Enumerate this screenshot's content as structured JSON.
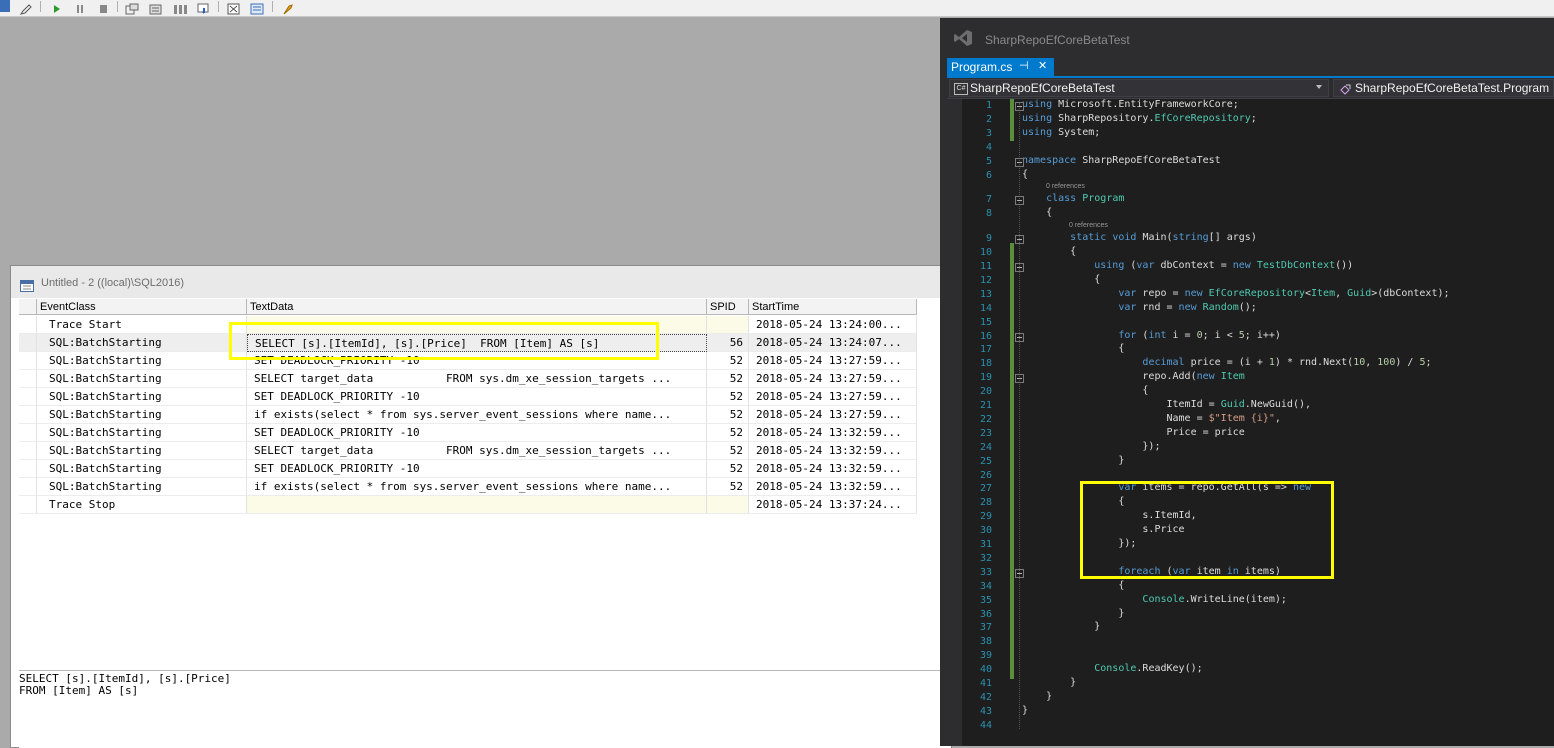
{
  "toolbar": {
    "icons": [
      "new-trace-icon",
      "edit-icon",
      "run-icon",
      "pause-icon",
      "stop-icon",
      "properties-icon",
      "clear-icon",
      "columns-icon",
      "filter-icon",
      "find-icon",
      "import-icon",
      "tools-icon",
      "tuning-icon"
    ]
  },
  "profiler": {
    "title": "Untitled - 2 ((local)\\SQL2016)",
    "columns": [
      "EventClass",
      "TextData",
      "SPID",
      "StartTime"
    ],
    "rows": [
      {
        "event": "Trace Start",
        "text": "",
        "spid": "",
        "start": "2018-05-24 13:24:00..."
      },
      {
        "event": "SQL:BatchStarting",
        "text": "SELECT [s].[ItemId], [s].[Price]  FROM [Item] AS [s]",
        "spid": "56",
        "start": "2018-05-24 13:24:07..."
      },
      {
        "event": "SQL:BatchStarting",
        "text": "SET DEADLOCK_PRIORITY -10",
        "spid": "52",
        "start": "2018-05-24 13:27:59..."
      },
      {
        "event": "SQL:BatchStarting",
        "text": "SELECT target_data           FROM sys.dm_xe_session_targets ...",
        "spid": "52",
        "start": "2018-05-24 13:27:59..."
      },
      {
        "event": "SQL:BatchStarting",
        "text": "SET DEADLOCK_PRIORITY -10",
        "spid": "52",
        "start": "2018-05-24 13:27:59..."
      },
      {
        "event": "SQL:BatchStarting",
        "text": "if exists(select * from sys.server_event_sessions where name...",
        "spid": "52",
        "start": "2018-05-24 13:27:59..."
      },
      {
        "event": "SQL:BatchStarting",
        "text": "SET DEADLOCK_PRIORITY -10",
        "spid": "52",
        "start": "2018-05-24 13:32:59..."
      },
      {
        "event": "SQL:BatchStarting",
        "text": "SELECT target_data           FROM sys.dm_xe_session_targets ...",
        "spid": "52",
        "start": "2018-05-24 13:32:59..."
      },
      {
        "event": "SQL:BatchStarting",
        "text": "SET DEADLOCK_PRIORITY -10",
        "spid": "52",
        "start": "2018-05-24 13:32:59..."
      },
      {
        "event": "SQL:BatchStarting",
        "text": "if exists(select * from sys.server_event_sessions where name...",
        "spid": "52",
        "start": "2018-05-24 13:32:59..."
      },
      {
        "event": "Trace Stop",
        "text": "",
        "spid": "",
        "start": "2018-05-24 13:37:24..."
      }
    ],
    "detail_text": "SELECT [s].[ItemId], [s].[Price]\nFROM [Item] AS [s]"
  },
  "vs": {
    "project_title": "SharpRepoEfCoreBetaTest",
    "tab_label": "Program.cs",
    "pin_glyph": "⊣",
    "close_glyph": "✕",
    "nav_left": "SharpRepoEfCoreBetaTest",
    "nav_right": "SharpRepoEfCoreBetaTest.Program",
    "nav_left_icon_text": "C#",
    "references_label": "0 references",
    "code_lines": [
      "using Microsoft.EntityFrameworkCore;",
      "using SharpRepository.EfCoreRepository;",
      "using System;",
      "",
      "namespace SharpRepoEfCoreBetaTest",
      "{",
      "    class Program",
      "    {",
      "        static void Main(string[] args)",
      "        {",
      "            using (var dbContext = new TestDbContext())",
      "            {",
      "                var repo = new EfCoreRepository<Item, Guid>(dbContext);",
      "                var rnd = new Random();",
      "",
      "                for (int i = 0; i < 5; i++)",
      "                {",
      "                    decimal price = (i + 1) * rnd.Next(10, 100) / 5;",
      "                    repo.Add(new Item",
      "                    {",
      "                        ItemId = Guid.NewGuid(),",
      "                        Name = $\"Item {i}\",",
      "                        Price = price",
      "                    });",
      "                }",
      "",
      "                var items = repo.GetAll(s => new",
      "                {",
      "                    s.ItemId,",
      "                    s.Price",
      "                });",
      "",
      "                foreach (var item in items)",
      "                {",
      "                    Console.WriteLine(item);",
      "                }",
      "            }",
      "",
      "",
      "            Console.ReadKey();",
      "        }",
      "    }",
      "}",
      ""
    ]
  }
}
